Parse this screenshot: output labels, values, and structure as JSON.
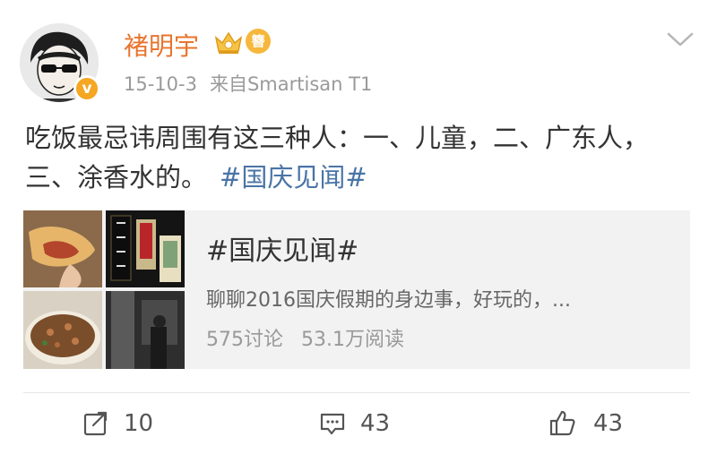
{
  "post": {
    "username": "褚明宇",
    "vip_badge": "簪",
    "verified_symbol": "v",
    "date": "15-10-3",
    "source": "来自Smartisan T1",
    "body_text": "吃饭最忌讳周围有这三种人：一、儿童，二、广东人，三、涂香水的。",
    "topic_link": "#国庆见闻#"
  },
  "topic_card": {
    "title": "#国庆见闻#",
    "description": "聊聊2016国庆假期的身边事，好玩的，...",
    "discussions": "575讨论",
    "views": "53.1万阅读"
  },
  "actions": {
    "repost_count": "10",
    "comment_count": "43",
    "like_count": "43"
  },
  "colors": {
    "username": "#e8742e",
    "topic_link": "#4a74a6",
    "card_background": "#f2f2f2",
    "verified_badge": "#f5a623"
  },
  "icons": [
    "chevron-down-icon",
    "crown-icon",
    "repost-icon",
    "comment-icon",
    "like-icon"
  ]
}
